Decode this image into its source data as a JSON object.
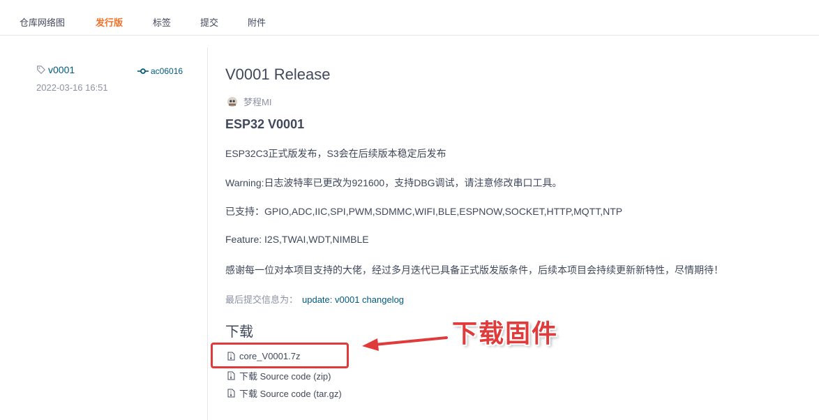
{
  "tabs": [
    {
      "label": "仓库网络图",
      "active": false
    },
    {
      "label": "发行版",
      "active": true
    },
    {
      "label": "标签",
      "active": false
    },
    {
      "label": "提交",
      "active": false
    },
    {
      "label": "附件",
      "active": false
    }
  ],
  "sidebar": {
    "tag": "v0001",
    "commit": "ac06016",
    "date": "2022-03-16 16:51"
  },
  "release": {
    "title": "V0001 Release",
    "author": "梦程MI",
    "heading": "ESP32 V0001",
    "paragraphs": [
      "ESP32C3正式版发布，S3会在后续版本稳定后发布",
      "Warning:日志波特率已更改为921600，支持DBG调试，请注意修改串口工具。",
      "已支持：GPIO,ADC,IIC,SPI,PWM,SDMMC,WIFI,BLE,ESPNOW,SOCKET,HTTP,MQTT,NTP",
      "Feature: I2S,TWAI,WDT,NIMBLE",
      "感谢每一位对本项目支持的大佬，经过多月迭代已具备正式版发版条件，后续本项目会持续更新新特性，尽情期待！"
    ],
    "last_commit_label": "最后提交信息为：",
    "last_commit_message": "update: v0001 changelog"
  },
  "downloads": {
    "title": "下载",
    "assets": [
      "core_V0001.7z",
      "下载 Source code (zip)",
      "下载 Source code (tar.gz)"
    ]
  },
  "annotation": {
    "text": "下载固件",
    "color": "#e03a3a"
  },
  "colors": {
    "accent": "#f27128",
    "link": "#005980",
    "muted": "#8c92a4"
  }
}
